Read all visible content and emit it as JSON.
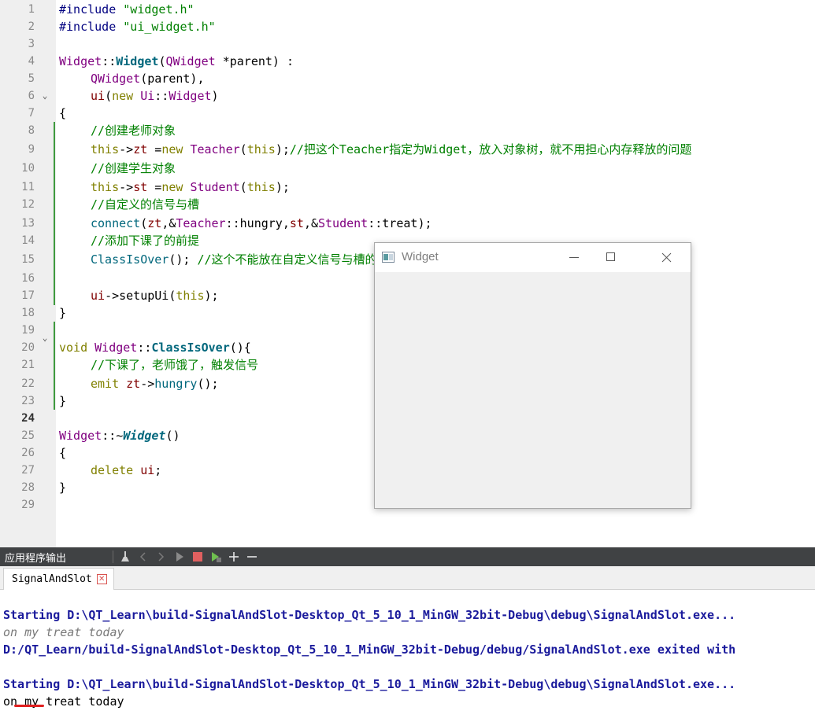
{
  "editor": {
    "line_numbers": [
      "1",
      "2",
      "3",
      "4",
      "5",
      "6",
      "7",
      "8",
      "9",
      "10",
      "11",
      "12",
      "13",
      "14",
      "15",
      "16",
      "17",
      "18",
      "19",
      "20",
      "21",
      "22",
      "23",
      "24",
      "25",
      "26",
      "27",
      "28",
      "29"
    ],
    "current_line": "24",
    "lines": {
      "l1": [
        "#include ",
        "\"widget.h\""
      ],
      "l2": [
        "#include ",
        "\"ui_widget.h\""
      ],
      "l4": [
        "Widget",
        "::",
        "Widget",
        "(",
        "QWidget",
        " *parent) :"
      ],
      "l5": [
        "QWidget",
        "(parent),"
      ],
      "l6": [
        "ui",
        "(",
        "new",
        " ",
        "Ui",
        "::",
        "Widget",
        ")"
      ],
      "l7": "{",
      "l8": "//创建老师对象",
      "l9": [
        "this",
        "->",
        "zt",
        " =",
        "new",
        " ",
        "Teacher",
        "(",
        "this",
        ");",
        "//把这个Teacher指定为Widget，放入对象树，就不用担心内存释放的问题"
      ],
      "l10": "//创建学生对象",
      "l11": [
        "this",
        "->",
        "st",
        " =",
        "new",
        " ",
        "Student",
        "(",
        "this",
        ");"
      ],
      "l12": "//自定义的信号与槽",
      "l13": [
        "connect",
        "(",
        "zt",
        ",&",
        "Teacher",
        "::",
        "hungry",
        ",",
        "st",
        ",&",
        "Student",
        "::",
        "treat",
        ");"
      ],
      "l14": "//添加下课了的前提",
      "l15": [
        "ClassIsOver",
        "(); ",
        "//这个不能放在自定义信号与槽的前面，因为只有在connect之后才会在条件达成触发信号"
      ],
      "l17": [
        "ui",
        "->",
        "setupUi",
        "(",
        "this",
        ");"
      ],
      "l18": "}",
      "l20": [
        "void",
        " ",
        "Widget",
        "::",
        "ClassIsOver",
        "(){"
      ],
      "l21": "//下课了，老师饿了，触发信号",
      "l22": [
        "emit",
        " ",
        "zt",
        "->",
        "hungry",
        "();"
      ],
      "l23": "}",
      "l25": [
        "Widget",
        "::~",
        "Widget",
        "()"
      ],
      "l26": "{",
      "l27": [
        "delete",
        " ",
        "ui",
        ";"
      ],
      "l28": "}"
    }
  },
  "widget_window": {
    "title": "Widget",
    "minimize_glyph": "—",
    "maximize_glyph": "☐",
    "close_glyph": "✕"
  },
  "output_pane": {
    "title": "应用程序输出",
    "tab_label": "SignalAndSlot",
    "tab_close_glyph": "✕",
    "lines": [
      "Starting D:\\QT_Learn\\build-SignalAndSlot-Desktop_Qt_5_10_1_MinGW_32bit-Debug\\debug\\SignalAndSlot.exe...",
      "on my treat today",
      "D:/QT_Learn/build-SignalAndSlot-Desktop_Qt_5_10_1_MinGW_32bit-Debug/debug/SignalAndSlot.exe exited with",
      "Starting D:\\QT_Learn\\build-SignalAndSlot-Desktop_Qt_5_10_1_MinGW_32bit-Debug\\debug\\SignalAndSlot.exe...",
      "on my treat today"
    ]
  },
  "colors": {
    "gutter_bg": "#efefef",
    "change_bar": "#3f9a3f",
    "toolbar_bg": "#404244",
    "comment": "#008000",
    "keyword": "#808000",
    "type": "#800080",
    "function": "#00677c",
    "output_start": "#1a1a9c",
    "annotation_red": "#e02020"
  },
  "icons": {
    "toolbar": [
      "clean-icon",
      "prev-icon",
      "next-icon",
      "run-icon",
      "stop-icon",
      "debug-run-icon",
      "zoom-in-icon",
      "zoom-out-icon"
    ],
    "window": "qt-window-icon"
  }
}
